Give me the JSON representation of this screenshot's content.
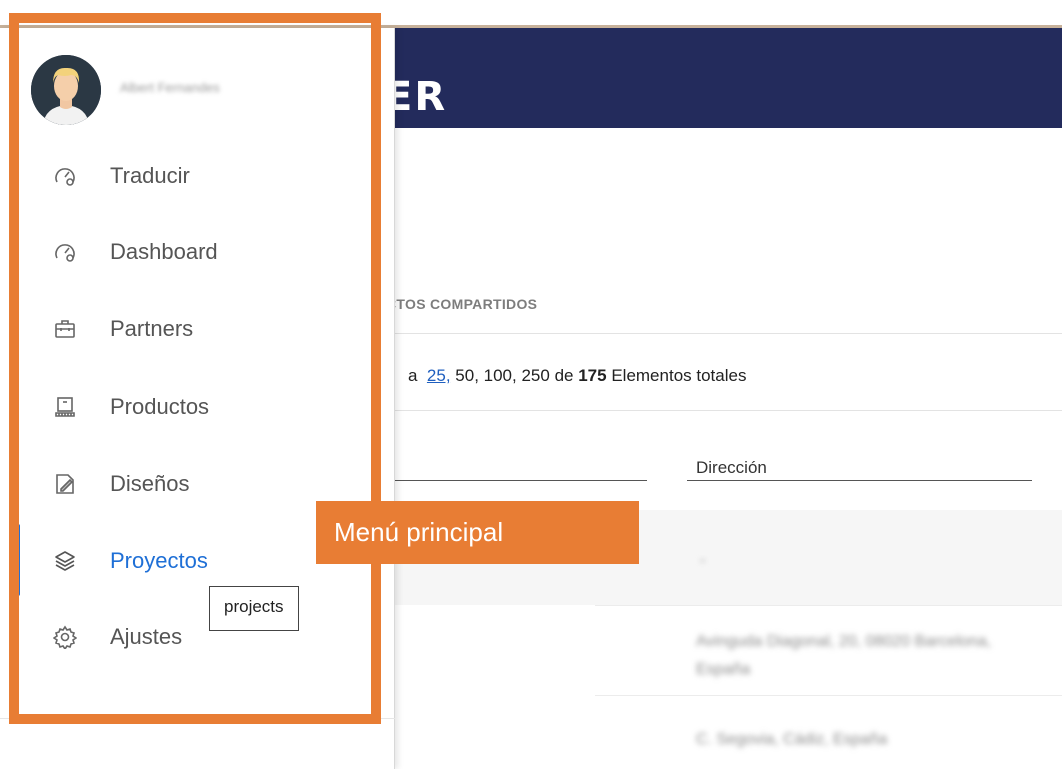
{
  "header": {
    "logo_text": "ER"
  },
  "tabs": {
    "shared_projects": "CTOS COMPARTIDOS"
  },
  "pager": {
    "prefix": "a",
    "option_active": "25,",
    "options_rest": "50, 100, 250",
    "de": "de",
    "total": "175",
    "suffix": "Elementos totales"
  },
  "table": {
    "columns": [
      "Dirección"
    ],
    "rows_blurred": [
      "-",
      "Avinguda Diagonal, 20, 08020 Barcelona, España",
      "C. Segovia, Cádiz, España"
    ]
  },
  "sidebar": {
    "user_name": "Albert Fernandes",
    "items": [
      {
        "label": "Traducir",
        "icon": "gauge-icon"
      },
      {
        "label": "Dashboard",
        "icon": "gauge-icon"
      },
      {
        "label": "Partners",
        "icon": "briefcase-icon"
      },
      {
        "label": "Productos",
        "icon": "machine-icon"
      },
      {
        "label": "Diseños",
        "icon": "pencil-paper-icon"
      },
      {
        "label": "Proyectos",
        "icon": "layers-icon",
        "active": true
      },
      {
        "label": "Ajustes",
        "icon": "gear-icon"
      }
    ],
    "tooltip": "projects"
  },
  "callout": {
    "label": "Menú principal",
    "color": "#e87d34"
  },
  "colors": {
    "accent": "#1e6fd6",
    "header_bg": "#232b5c"
  }
}
